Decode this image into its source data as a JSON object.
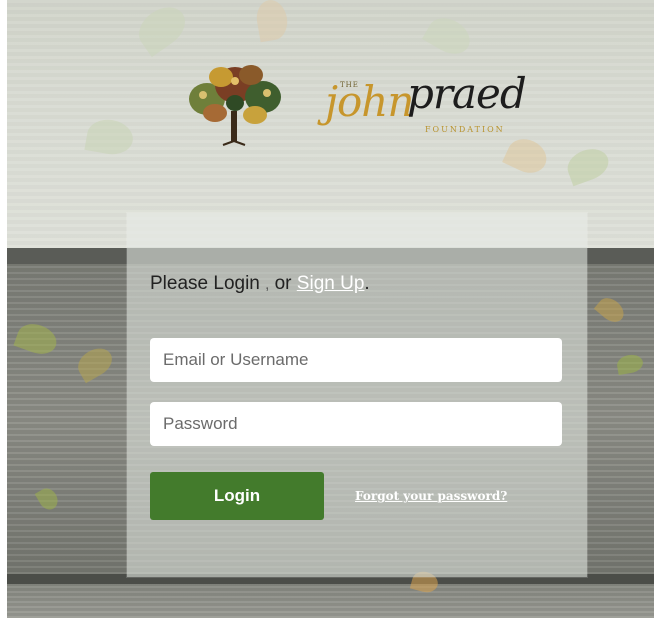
{
  "logo": {
    "alt": "The John Praed Foundation",
    "the": "THE",
    "john": "john",
    "praed": "praed",
    "foundation": "FOUNDATION",
    "colors": {
      "gold": "#c7962c",
      "dark": "#1d1d1d"
    }
  },
  "login": {
    "prompt_text": "Please Login",
    "separator": ",",
    "or_text": "or",
    "signup_label": "Sign Up",
    "period": ".",
    "email_placeholder": "Email or Username",
    "password_placeholder": "Password",
    "login_button": "Login",
    "forgot_link": "Forgot your password?",
    "button_color": "#437b2c"
  }
}
